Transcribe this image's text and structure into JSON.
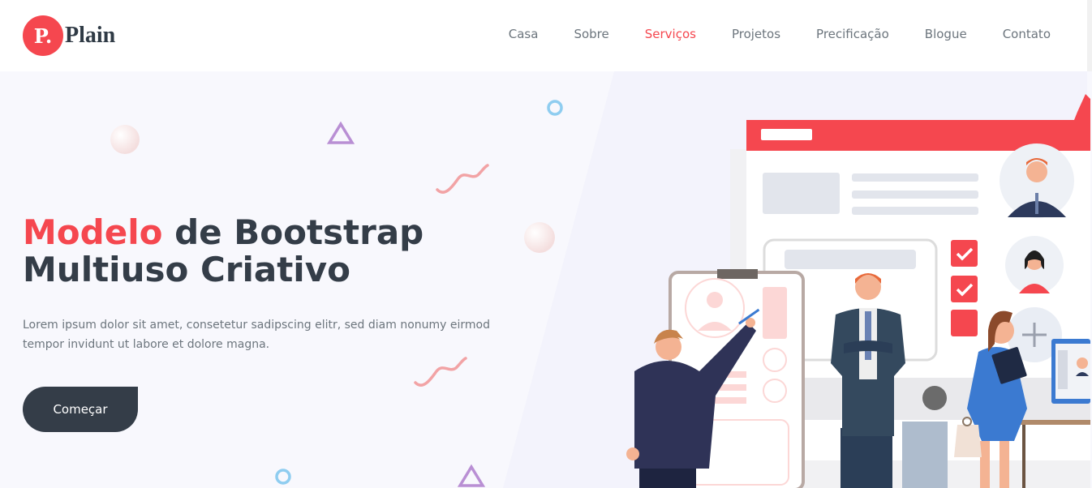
{
  "brand": {
    "badge": "P.",
    "name": "Plain",
    "accent_color": "#f5474f",
    "dark_color": "#343d48"
  },
  "nav": {
    "items": [
      {
        "label": "Casa",
        "active": false
      },
      {
        "label": "Sobre",
        "active": false
      },
      {
        "label": "Serviços",
        "active": true
      },
      {
        "label": "Projetos",
        "active": false
      },
      {
        "label": "Precificação",
        "active": false
      },
      {
        "label": "Blogue",
        "active": false
      },
      {
        "label": "Contato",
        "active": false
      }
    ]
  },
  "hero": {
    "headline_accent": "Modelo",
    "headline_rest_1": " de Bootstrap",
    "headline_line_2": "Multiuso Criativo",
    "subtitle": "Lorem ipsum dolor sit amet, consetetur sadipscing elitr, sed diam nonumy eirmod tempor invidunt ut labore et dolore magna.",
    "cta_label": "Começar"
  },
  "icons": {
    "shapes": [
      "circle-outline-icon",
      "triangle-outline-icon",
      "squiggle-icon",
      "sphere-icon"
    ],
    "illustration": [
      "checkbox-checked-icon",
      "plus-icon",
      "user-avatar-icon"
    ]
  }
}
